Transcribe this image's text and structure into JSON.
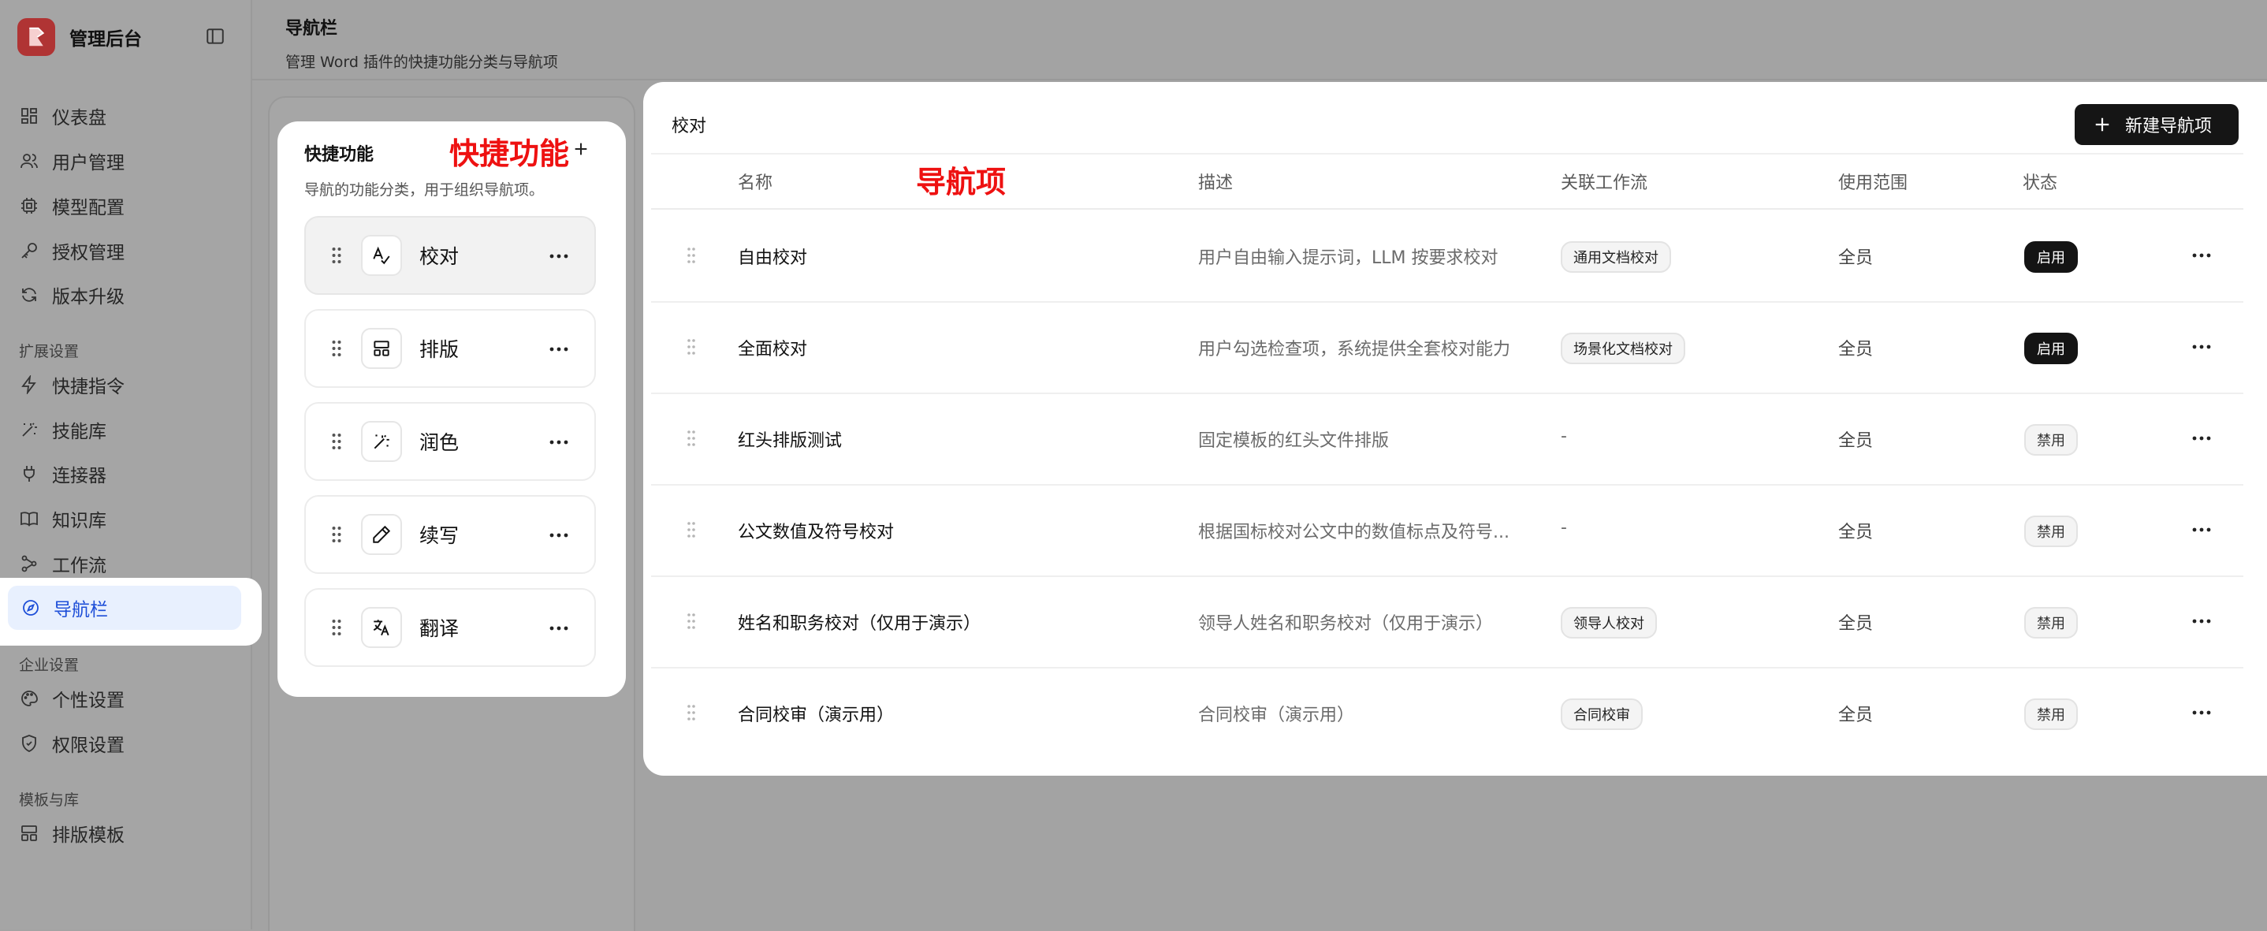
{
  "brand": {
    "name": "管理后台"
  },
  "sidebar": {
    "main": [
      {
        "label": "仪表盘",
        "icon": "dashboard-icon"
      },
      {
        "label": "用户管理",
        "icon": "users-icon"
      },
      {
        "label": "模型配置",
        "icon": "cpu-icon"
      },
      {
        "label": "授权管理",
        "icon": "key-icon"
      },
      {
        "label": "版本升级",
        "icon": "refresh-icon"
      }
    ],
    "group_ext": "扩展设置",
    "ext": [
      {
        "label": "快捷指令",
        "icon": "zap-icon"
      },
      {
        "label": "技能库",
        "icon": "wand-icon"
      },
      {
        "label": "连接器",
        "icon": "plug-icon"
      },
      {
        "label": "知识库",
        "icon": "book-icon"
      },
      {
        "label": "工作流",
        "icon": "workflow-icon"
      },
      {
        "label": "导航栏",
        "icon": "compass-icon",
        "active": true
      }
    ],
    "group_ent": "企业设置",
    "ent": [
      {
        "label": "个性设置",
        "icon": "palette-icon"
      },
      {
        "label": "权限设置",
        "icon": "shield-icon"
      }
    ],
    "group_tpl": "模板与库",
    "tpl": [
      {
        "label": "排版模板",
        "icon": "layout-icon"
      }
    ]
  },
  "header": {
    "title": "导航栏",
    "subtitle": "管理 Word 插件的快捷功能分类与导航项"
  },
  "quick_functions": {
    "title": "快捷功能",
    "annotation": "快捷功能",
    "subtitle": "导航的功能分类，用于组织导航项。",
    "items": [
      {
        "label": "校对",
        "icon": "spellcheck-icon",
        "selected": true
      },
      {
        "label": "排版",
        "icon": "layout-icon"
      },
      {
        "label": "润色",
        "icon": "wand-icon"
      },
      {
        "label": "续写",
        "icon": "pen-icon"
      },
      {
        "label": "翻译",
        "icon": "translate-icon"
      }
    ]
  },
  "nav_items": {
    "breadcrumb": "校对",
    "annotation": "导航项",
    "new_button": "新建导航项",
    "columns": {
      "name": "名称",
      "desc": "描述",
      "flow": "关联工作流",
      "scope": "使用范围",
      "status": "状态"
    },
    "rows": [
      {
        "name": "自由校对",
        "desc": "用户自由输入提示词，LLM 按要求校对",
        "flow": "通用文档校对",
        "scope": "全员",
        "status": "启用",
        "enabled": true
      },
      {
        "name": "全面校对",
        "desc": "用户勾选检查项，系统提供全套校对能力",
        "flow": "场景化文档校对",
        "scope": "全员",
        "status": "启用",
        "enabled": true
      },
      {
        "name": "红头排版测试",
        "desc": "固定模板的红头文件排版",
        "flow": "-",
        "scope": "全员",
        "status": "禁用",
        "enabled": false
      },
      {
        "name": "公文数值及符号校对",
        "desc": "根据国标校对公文中的数值标点及符号...",
        "flow": "-",
        "scope": "全员",
        "status": "禁用",
        "enabled": false
      },
      {
        "name": "姓名和职务校对（仅用于演示）",
        "desc": "领导人姓名和职务校对（仅用于演示）",
        "flow": "领导人校对",
        "scope": "全员",
        "status": "禁用",
        "enabled": false
      },
      {
        "name": "合同校审（演示用）",
        "desc": "合同校审（演示用）",
        "flow": "合同校审",
        "scope": "全员",
        "status": "禁用",
        "enabled": false
      }
    ]
  },
  "colors": {
    "overlay": "#a3a3a3",
    "accent": "#1d4ed8",
    "annotation": "#ee1111",
    "brand": "#b03434"
  }
}
